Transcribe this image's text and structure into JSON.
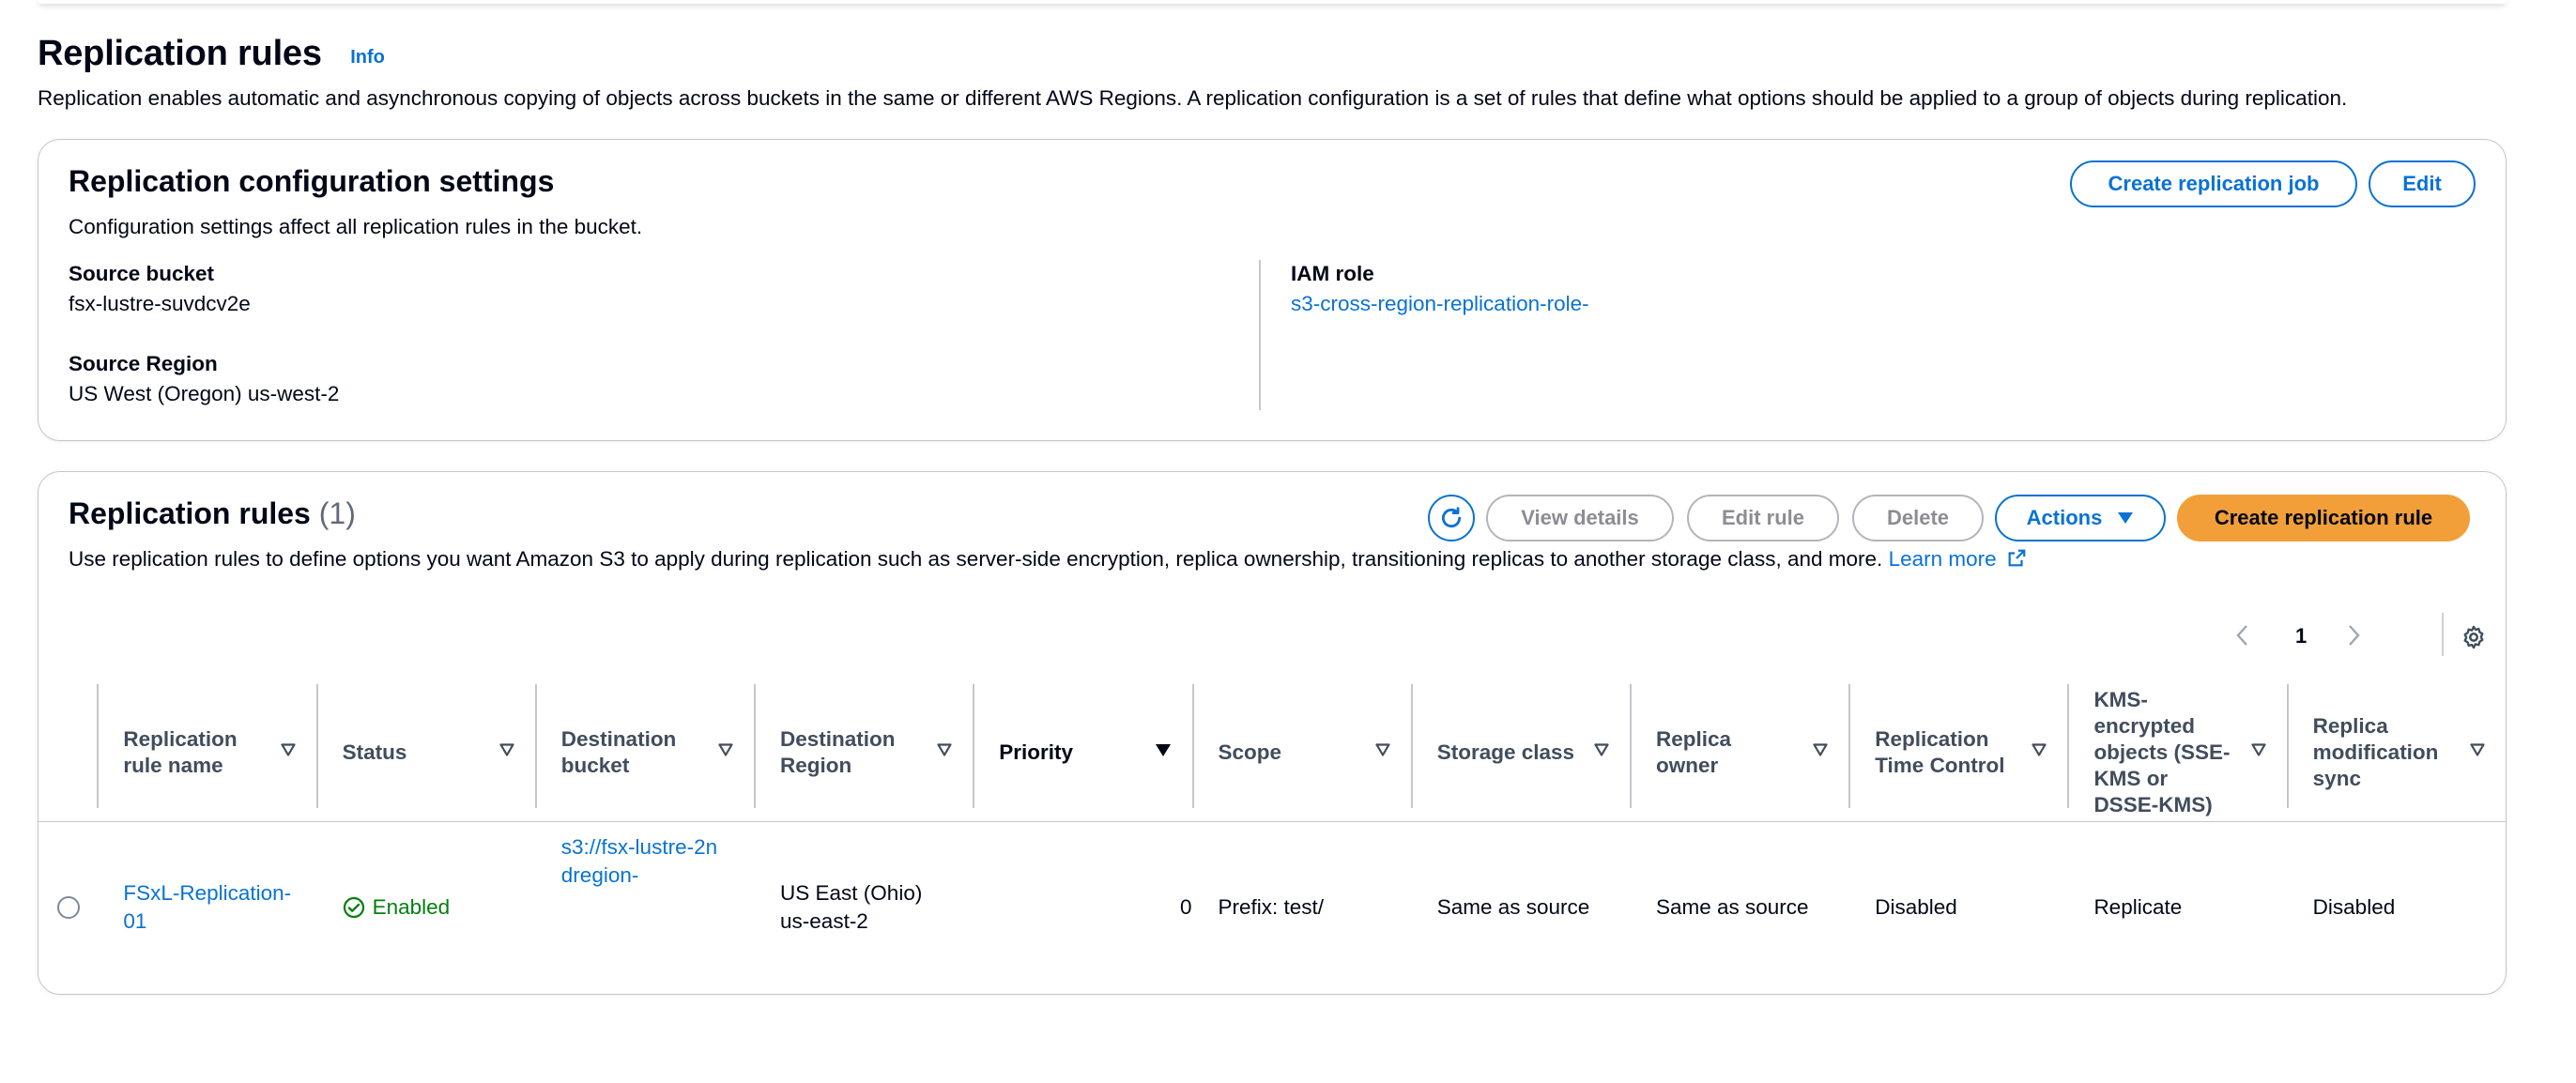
{
  "header": {
    "title": "Replication rules",
    "info": "Info",
    "description": "Replication enables automatic and asynchronous copying of objects across buckets in the same or different AWS Regions. A replication configuration is a set of rules that define what options should be applied to a group of objects during replication."
  },
  "config": {
    "title": "Replication configuration settings",
    "description": "Configuration settings affect all replication rules in the bucket.",
    "create_job_label": "Create replication job",
    "edit_label": "Edit",
    "source_bucket_label": "Source bucket",
    "source_bucket_value": "fsx-lustre-suvdcv2e",
    "source_region_label": "Source Region",
    "source_region_value": "US West (Oregon) us-west-2",
    "iam_role_label": "IAM role",
    "iam_role_value": "s3-cross-region-replication-role-"
  },
  "rules": {
    "title": "Replication rules",
    "count": "(1)",
    "view_details_label": "View details",
    "edit_rule_label": "Edit rule",
    "delete_label": "Delete",
    "actions_label": "Actions",
    "create_rule_label": "Create replication rule",
    "description": "Use replication rules to define options you want Amazon S3 to apply during replication such as server-side encryption, replica ownership, transitioning replicas to another storage class, and more.",
    "learn_more": "Learn more",
    "page": "1",
    "columns": {
      "name": "Replication rule name",
      "status": "Status",
      "dest_bucket": "Destination bucket",
      "dest_region": "Destination Region",
      "priority": "Priority",
      "scope": "Scope",
      "storage_class": "Storage class",
      "replica_owner": "Replica owner",
      "rtc": "Replication Time Control",
      "kms": "KMS-encrypted objects (SSE-KMS or DSSE-KMS)",
      "mod_sync": "Replica modification sync"
    },
    "rows": [
      {
        "name": "FSxL-Replication-01",
        "status": "Enabled",
        "dest_bucket": "s3://fsx-lustre-2ndregion-",
        "dest_region": "US East (Ohio) us-east-2",
        "priority": "0",
        "scope": "Prefix: test/",
        "storage_class": "Same as source",
        "replica_owner": "Same as source",
        "rtc": "Disabled",
        "kms": "Replicate",
        "mod_sync": "Disabled"
      }
    ]
  },
  "colors": {
    "link": "#0972d3",
    "primary_button": "#f29f3a",
    "success": "#037f0c",
    "border": "#c6c6cd"
  }
}
